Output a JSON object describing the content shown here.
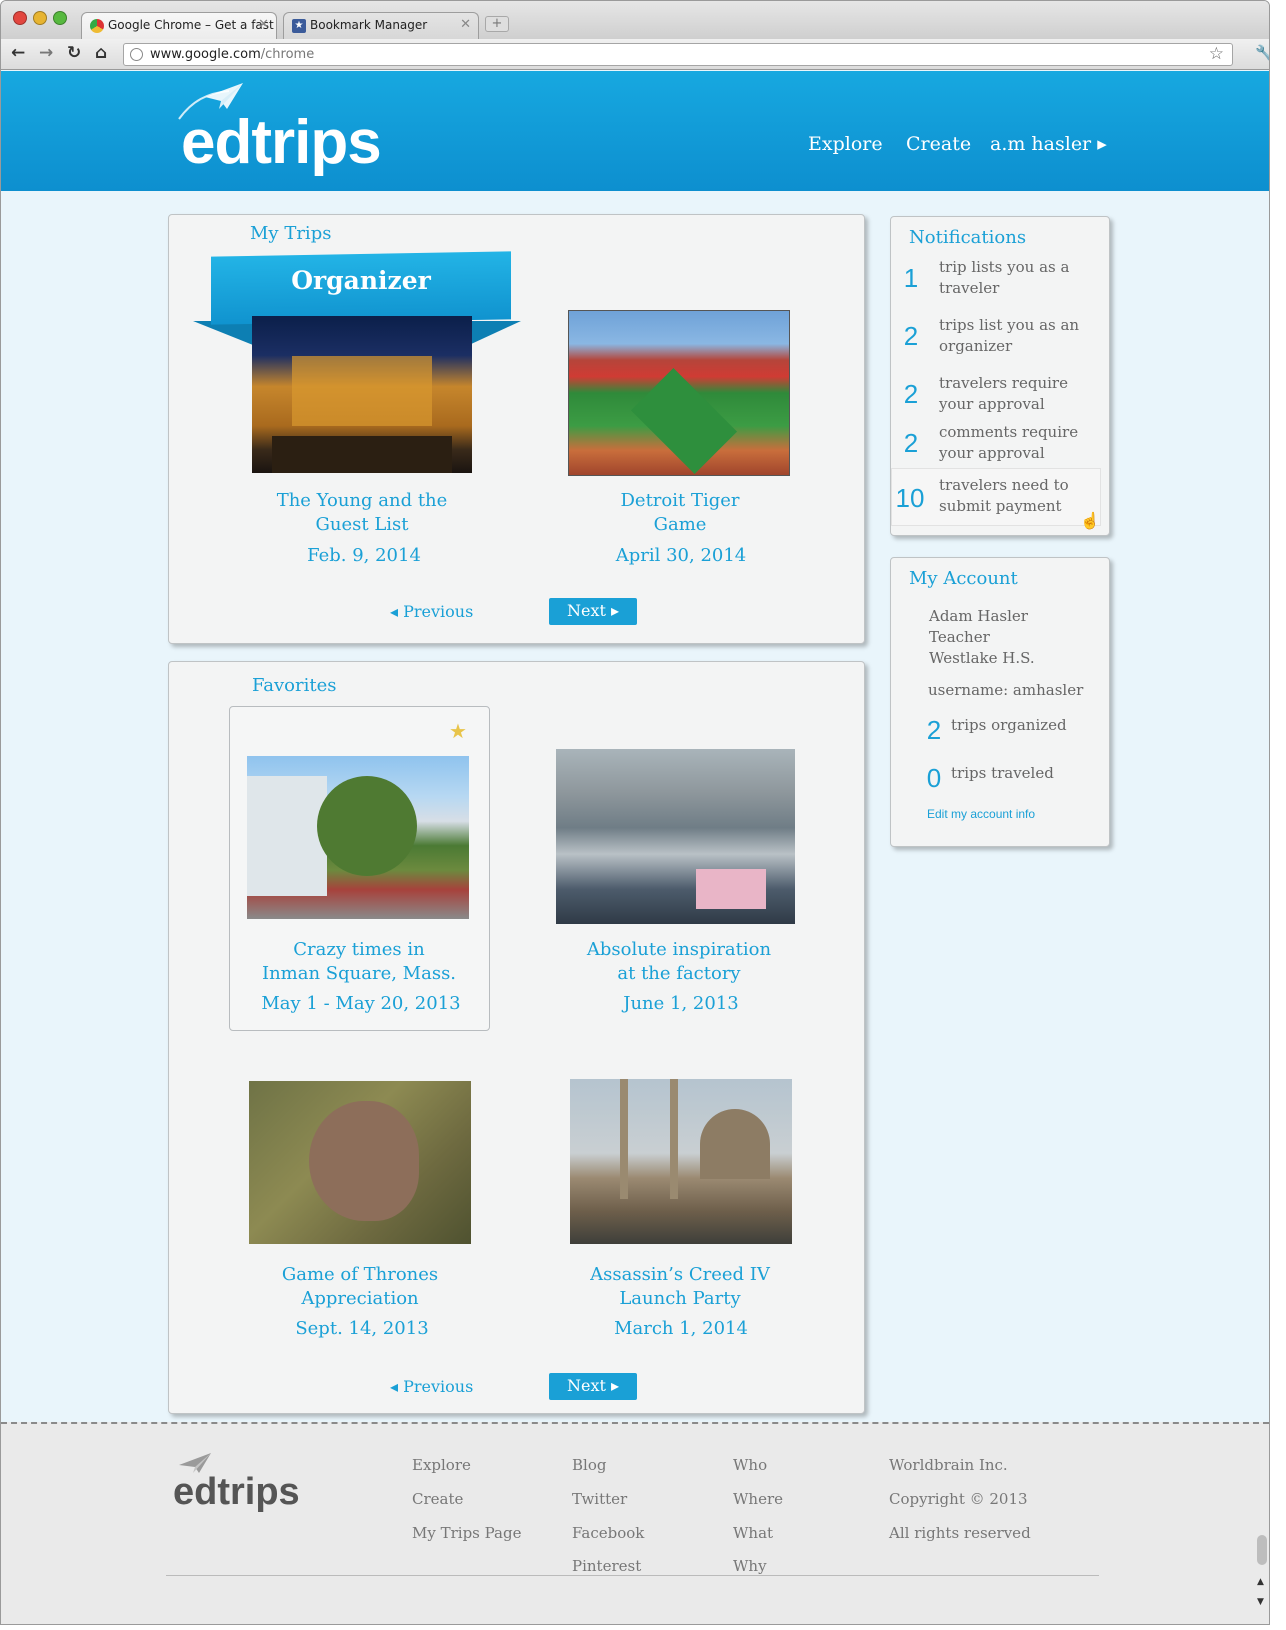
{
  "browser": {
    "tabs": [
      {
        "label": "Google Chrome – Get a fast"
      },
      {
        "label": "Bookmark Manager"
      }
    ],
    "url_host": "www.google.com",
    "url_path": "/chrome"
  },
  "site": {
    "logo": "edtrips",
    "nav": {
      "explore": "Explore",
      "create": "Create",
      "user": "a.m hasler"
    }
  },
  "my_trips": {
    "heading": "My Trips",
    "banner": "Organizer",
    "trips": [
      {
        "title_line1": "The Young and the",
        "title_line2": "Guest List",
        "date": "Feb. 9, 2014"
      },
      {
        "title_line1": "Detroit Tiger",
        "title_line2": "Game",
        "date": "April 30, 2014"
      }
    ],
    "prev": "Previous",
    "next": "Next"
  },
  "favorites": {
    "heading": "Favorites",
    "trips": [
      {
        "title_line1": "Crazy times in",
        "title_line2": "Inman Square, Mass.",
        "date": "May 1 - May 20, 2013"
      },
      {
        "title_line1": "Absolute inspiration",
        "title_line2": "at the factory",
        "date": "June 1, 2013"
      },
      {
        "title_line1": "Game of Thrones",
        "title_line2": "Appreciation",
        "date": "Sept. 14, 2013"
      },
      {
        "title_line1": "Assassin’s Creed IV",
        "title_line2": "Launch Party",
        "date": "March 1, 2014"
      }
    ],
    "prev": "Previous",
    "next": "Next"
  },
  "notifications": {
    "heading": "Notifications",
    "items": [
      {
        "count": "1",
        "line1": "trip lists you as a",
        "line2": "traveler"
      },
      {
        "count": "2",
        "line1": "trips list you as an",
        "line2": "organizer"
      },
      {
        "count": "2",
        "line1": "travelers require",
        "line2": "your approval"
      },
      {
        "count": "2",
        "line1": "comments require",
        "line2": "your approval"
      },
      {
        "count": "10",
        "line1": "travelers need to",
        "line2": "submit payment"
      }
    ]
  },
  "account": {
    "heading": "My Account",
    "name": "Adam Hasler",
    "role": "Teacher",
    "school": "Westlake H.S.",
    "username": "username: amhasler",
    "organized_count": "2",
    "organized_label": "trips organized",
    "traveled_count": "0",
    "traveled_label": "trips traveled",
    "edit_link": "Edit my account info"
  },
  "footer": {
    "logo": "edtrips",
    "col1": [
      "Explore",
      "Create",
      "My Trips Page"
    ],
    "col2": [
      "Blog",
      "Twitter",
      "Facebook",
      "Pinterest"
    ],
    "col3": [
      "Who",
      "Where",
      "What",
      "Why"
    ],
    "col4": [
      "Worldbrain Inc.",
      "Copyright © 2013",
      "All rights reserved"
    ]
  },
  "colors": {
    "brand": "#1aa0d6",
    "header": "#17a8e0",
    "page_bg": "#e9f5fb"
  }
}
